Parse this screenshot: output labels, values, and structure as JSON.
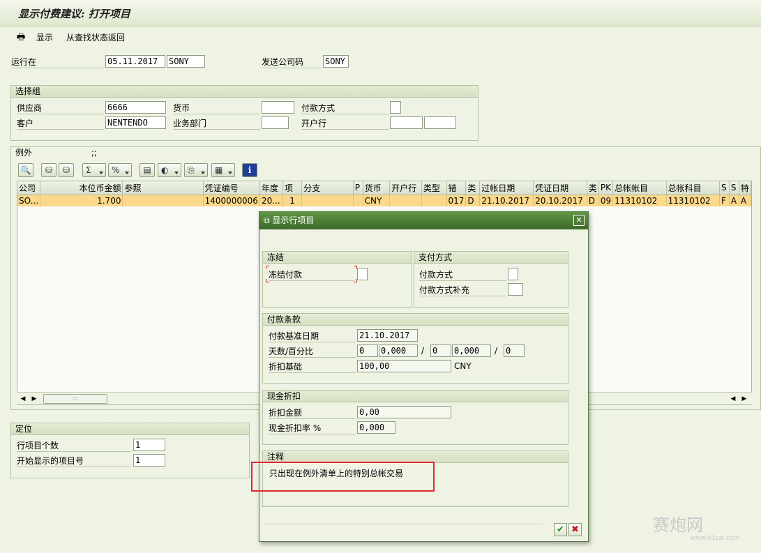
{
  "title": "显示付费建议: 打开项目",
  "toolbar": {
    "display": "显示",
    "back": "从查找状态返回"
  },
  "header": {
    "run_on_label": "运行在",
    "run_on_date": "05.11.2017",
    "run_on_id": "SONY",
    "sending_cc_label": "发送公司码",
    "sending_cc": "SONY"
  },
  "selection": {
    "title": "选择组",
    "vendor_label": "供应商",
    "vendor": "6666",
    "currency_label": "货币",
    "currency": "",
    "pay_method_label": "付款方式",
    "pay_method": "",
    "customer_label": "客户",
    "customer": "NENTENDO",
    "business_area_label": "业务部门",
    "business_area": "",
    "house_bank_label": "开户行",
    "house_bank": "",
    "house_bank2": ""
  },
  "exceptions": {
    "title": "例外",
    "subtitle": ";;",
    "columns": [
      "公司",
      "本位币金额",
      "参照",
      "凭证编号",
      "年度",
      "项",
      "分支",
      "P",
      "货币",
      "开户行",
      "类型",
      "错",
      "类",
      "过帐日期",
      "凭证日期",
      "类",
      "PK",
      "总帐帐目",
      "总帐科目",
      "S",
      "S",
      "特"
    ],
    "rows": [
      [
        "SO...",
        "1.700",
        "",
        "1400000006",
        "20...",
        "1",
        "",
        "",
        "CNY",
        "",
        "",
        "017",
        "D",
        "21.10.2017",
        "20.10.2017",
        "D",
        "09",
        "11310102",
        "11310102",
        "F",
        "A",
        "A"
      ]
    ],
    "scroll_thumb": ":::"
  },
  "position": {
    "title": "定位",
    "line_items_label": "行项目个数",
    "line_items": "1",
    "first_item_label": "开始显示的项目号",
    "first_item": "1"
  },
  "dialog": {
    "title": "显示行项目",
    "freeze": {
      "title": "冻结",
      "block_label": "冻结付款",
      "block": ""
    },
    "payment_method": {
      "title": "支付方式",
      "method_label": "付款方式",
      "method": "",
      "supplement_label": "付款方式补充",
      "supplement": ""
    },
    "terms": {
      "title": "付款条款",
      "baseline_label": "付款基准日期",
      "baseline": "21.10.2017",
      "days_label": "天数/百分比",
      "days1": "0",
      "pct1": "0,000",
      "days2": "0",
      "pct2": "0,000",
      "days3": "0",
      "slash": "/",
      "discount_base_label": "折扣基础",
      "discount_base": "100,00",
      "discount_currency": "CNY"
    },
    "cash_discount": {
      "title": "现金折扣",
      "amount_label": "折扣金额",
      "amount": "0,00",
      "rate_label": "现金折扣率 %",
      "rate": "0,000"
    },
    "note": {
      "title": "注释",
      "text": "只出现在例外清单上的特别总帐交易"
    }
  },
  "watermark": {
    "text": "赛炮网",
    "url": "www.91sai.com"
  },
  "colors": {
    "selected_row": "#fbd88a",
    "dialog_header": "#4b7d36",
    "highlight_box": "#e0282d"
  }
}
